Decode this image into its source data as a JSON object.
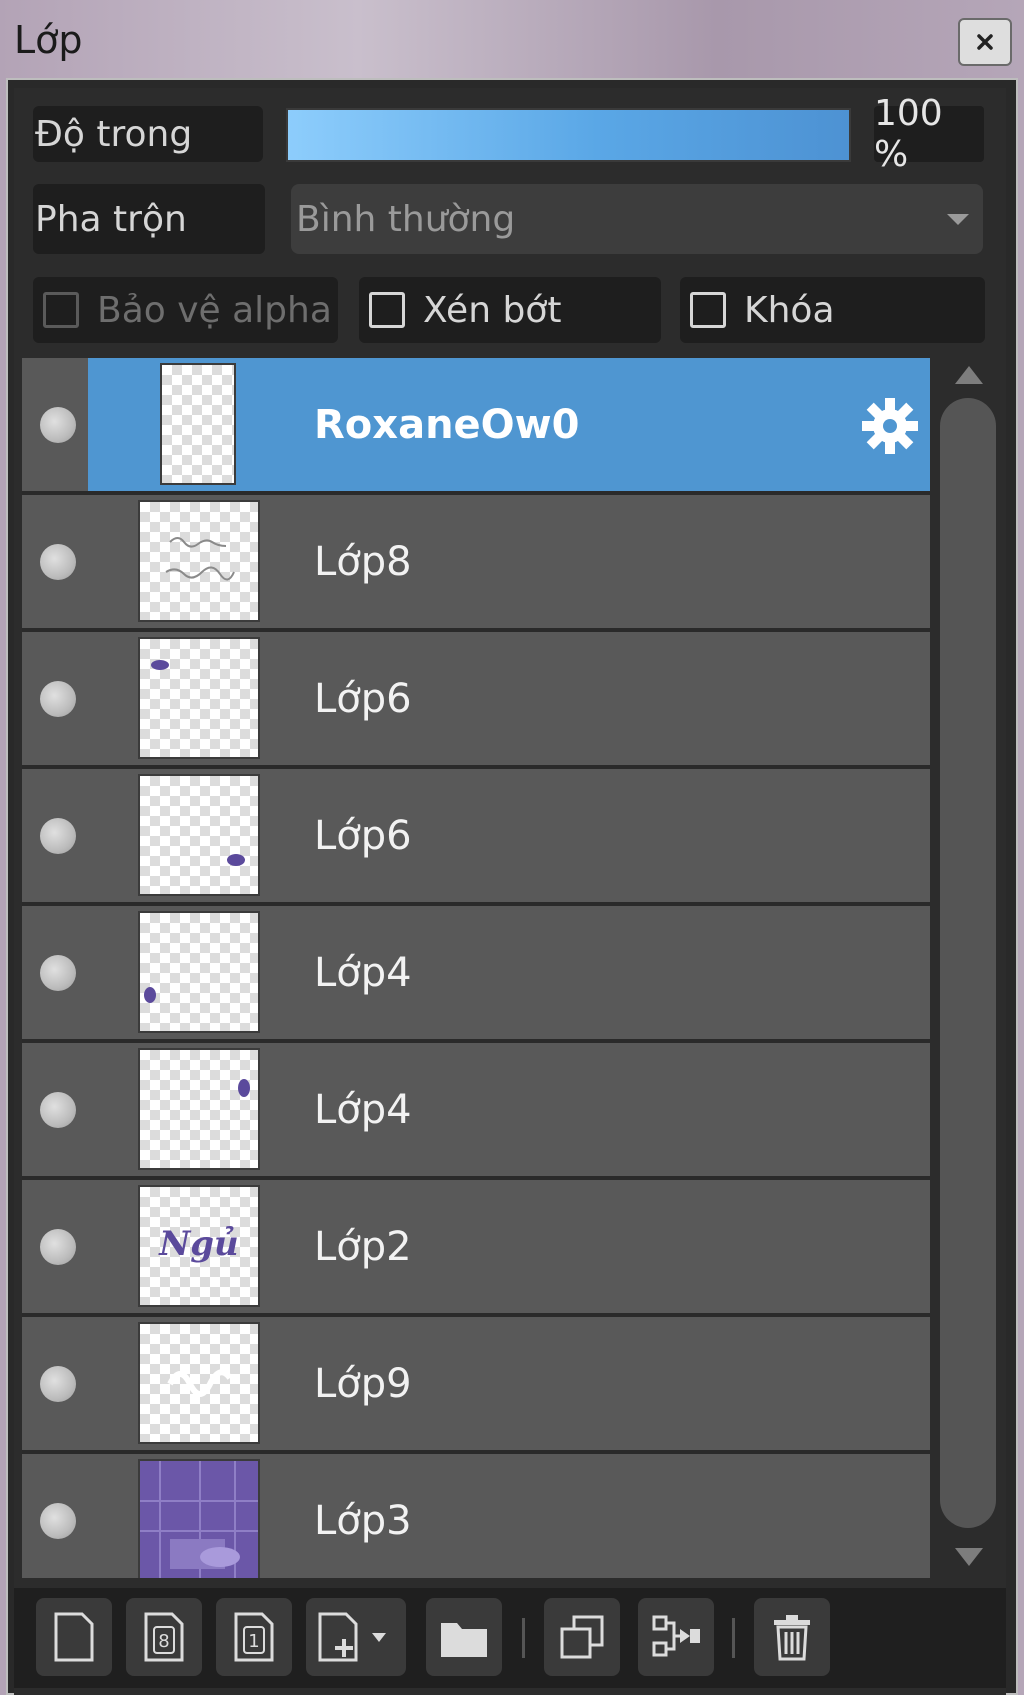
{
  "window": {
    "title": "Lớp",
    "close_label": "×"
  },
  "opacity": {
    "label": "Độ trong",
    "value_text": "100 %",
    "value_fraction": 1.0
  },
  "blend": {
    "label": "Pha trộn",
    "selected": "Bình thường"
  },
  "options": {
    "protect_alpha": {
      "label": "Bảo vệ alpha",
      "checked": false,
      "disabled": true
    },
    "clipping": {
      "label": "Xén bớt",
      "checked": false
    },
    "lock": {
      "label": "Khóa",
      "checked": false
    }
  },
  "layers": [
    {
      "name": "RoxaneOw0",
      "selected": true,
      "thumb": "blank-tall",
      "settings_icon": "gear-icon"
    },
    {
      "name": "Lớp8",
      "selected": false,
      "thumb": "handwriting-small"
    },
    {
      "name": "Lớp6",
      "selected": false,
      "thumb": "purple-mark-topleft"
    },
    {
      "name": "Lớp6",
      "selected": false,
      "thumb": "purple-mark-bottomright"
    },
    {
      "name": "Lớp4",
      "selected": false,
      "thumb": "purple-mark-left"
    },
    {
      "name": "Lớp4",
      "selected": false,
      "thumb": "purple-mark-topright"
    },
    {
      "name": "Lớp2",
      "selected": false,
      "thumb": "text-ngu"
    },
    {
      "name": "Lớp9",
      "selected": false,
      "thumb": "white-text"
    },
    {
      "name": "Lớp3",
      "selected": false,
      "thumb": "purple-photo"
    }
  ],
  "thumb_text": {
    "ngu": "Ngủ"
  },
  "toolbar": {
    "buttons": [
      {
        "icon": "new-layer-icon"
      },
      {
        "icon": "new-8bit-layer-icon",
        "glyph": "8"
      },
      {
        "icon": "new-1bit-layer-icon",
        "glyph": "1"
      },
      {
        "icon": "add-layer-menu-icon"
      },
      {
        "icon": "new-folder-icon"
      },
      {
        "icon": "duplicate-layer-icon"
      },
      {
        "icon": "merge-down-icon"
      },
      {
        "icon": "delete-layer-icon"
      }
    ]
  },
  "colors": {
    "selection": "#4f96d1",
    "slider_start": "#8dcdfc",
    "slider_end": "#4d92d3",
    "row": "#595959"
  }
}
